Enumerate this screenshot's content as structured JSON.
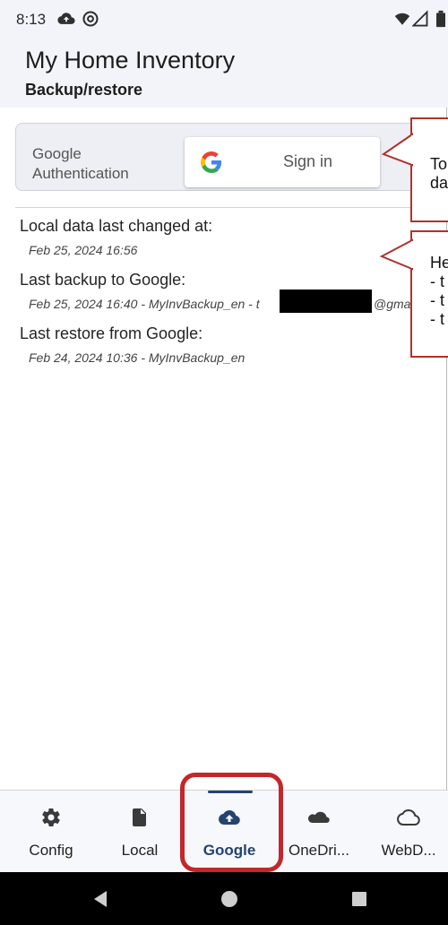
{
  "status_bar": {
    "time": "8:13",
    "icons": [
      "cloud-upload-icon",
      "sync-circle-icon",
      "wifi-icon",
      "signal-icon",
      "battery-icon"
    ]
  },
  "header": {
    "title": "My Home Inventory",
    "subtitle": "Backup/restore"
  },
  "auth": {
    "label": "Google\nAuthentication",
    "signin_label": "Sign in"
  },
  "info": {
    "local_changed_label": "Local data last changed at:",
    "local_changed_value": "Feb 25, 2024 16:56",
    "last_backup_label": "Last backup to Google:",
    "last_backup_value": "Feb 25, 2024 16:40 - MyInvBackup_en - t",
    "last_backup_email_tail": "@gmai",
    "last_restore_label": "Last restore from Google:",
    "last_restore_value": "Feb 24, 2024 10:36 - MyInvBackup_en"
  },
  "tooltips": [
    {
      "text": "To\nda"
    },
    {
      "text": "He\n- t\n- t\n- t"
    }
  ],
  "bottom_nav": {
    "items": [
      {
        "label": "Config",
        "icon": "gear-icon"
      },
      {
        "label": "Local",
        "icon": "file-icon"
      },
      {
        "label": "Google",
        "icon": "cloud-upload-icon",
        "active": true
      },
      {
        "label": "OneDri...",
        "icon": "onedrive-cloud-icon"
      },
      {
        "label": "WebD...",
        "icon": "cloud-outline-icon"
      }
    ]
  },
  "colors": {
    "accent": "#24436f",
    "highlight": "#c3272b",
    "header_bg": "#f2f4fa"
  }
}
